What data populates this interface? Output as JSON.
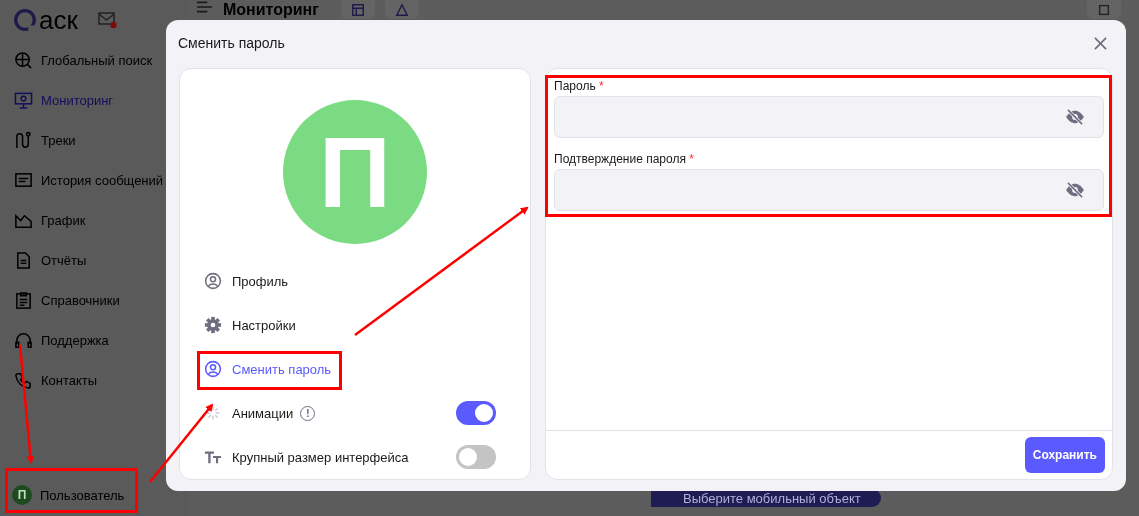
{
  "sidebar": {
    "logo": "аск",
    "items": [
      {
        "label": "Глобальный поиск",
        "selected": false
      },
      {
        "label": "Мониторинг",
        "selected": true
      },
      {
        "label": "Треки",
        "selected": false
      },
      {
        "label": "История сообщений",
        "selected": false
      },
      {
        "label": "График",
        "selected": false
      },
      {
        "label": "Отчёты",
        "selected": false
      },
      {
        "label": "Справочники",
        "selected": false
      },
      {
        "label": "Поддержка",
        "selected": false
      },
      {
        "label": "Контакты",
        "selected": false
      }
    ],
    "user": {
      "initial": "П",
      "name": "Пользователь"
    }
  },
  "header": {
    "title": "Мониторинг"
  },
  "map_button": "Выберите мобильный объект",
  "dialog": {
    "title": "Сменить пароль",
    "avatar_initial": "П",
    "menu": [
      {
        "kind": "link",
        "label": "Профиль",
        "selected": false
      },
      {
        "kind": "link",
        "label": "Настройки",
        "selected": false
      },
      {
        "kind": "link",
        "label": "Сменить пароль",
        "selected": true
      },
      {
        "kind": "toggle",
        "label": "Анимации",
        "info": "!",
        "on": true
      },
      {
        "kind": "toggle",
        "label": "Крупный размер интерфейса",
        "on": false
      }
    ],
    "fields": [
      {
        "label": "Пароль",
        "required_mark": "*"
      },
      {
        "label": "Подтверждение пароля",
        "required_mark": "*"
      }
    ],
    "save": "Сохранить"
  }
}
